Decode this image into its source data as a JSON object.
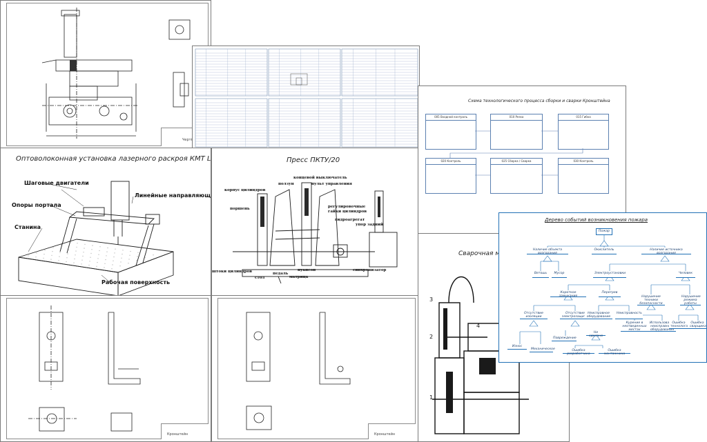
{
  "sheets": {
    "laser_title": "Оптоволоконная установка лазерного раскроя   КМТ L1",
    "laser_labels": {
      "steppers": "Шаговые двигатели",
      "linear_guides": "Линейные направляющие",
      "portal_supports": "Опоры портала",
      "bed": "Станина",
      "work_surface": "Рабочая поверхность"
    },
    "press_title": "Пресс ПКТУ/20",
    "press_labels": {
      "limit_switch": "концевой выключатель",
      "control_panel": "пульт управления",
      "frame": "ползун",
      "cylinder_body": "корпус цилиндров",
      "piston": "поршень",
      "adjusting_nuts": "регулировочные гайки цилиндров",
      "hydraulic_unit": "гидроагрегат",
      "back_stop": "упор задний",
      "cylinder_rods": "штоки цилиндров",
      "table": "стол",
      "pedal": "педаль",
      "punch": "пуансон",
      "die": "матрица",
      "synchronizer": "синхронизатор"
    },
    "process_title": "Схема технологического процесса сборки и сварки Кронштейна",
    "process_boxes": [
      "005 Входной контроль",
      "010 Резка",
      "015 Гибка",
      "020 Контроль",
      "025 Сборка / Сварка",
      "030 Контроль"
    ],
    "welding_title": "Сварочная машина",
    "welding_numbers": [
      "3",
      "2",
      "4",
      "1"
    ],
    "tree_title": "Дерево событий возникновения пожара",
    "tree_nodes": {
      "root": "Пожар",
      "n1": "Наличие объекта возгорания",
      "n2": "Окислитель",
      "n3": "Наличие источника возгорания",
      "n4": "Ветошь",
      "n5": "Мусор",
      "n6": "Электроустановки",
      "n7": "Человек",
      "n8": "Короткое замыкание",
      "n9": "Перегрев",
      "n10": "Нарушение техники безопасности",
      "n11": "Нарушение режима работы",
      "n12": "Отсутствие изоляции",
      "n13": "Отсутствие электрозащиты",
      "n14": "Неисправное оборудование",
      "n15": "Неисправность",
      "n16": "Курение в неотведенных местах",
      "n17": "Использование неисправного оборудования",
      "n18": "Ошибка технолога",
      "n19": "Ошибка сварщика",
      "n20": "Не сделано",
      "n21": "Износ",
      "n22": "Повреждение",
      "n23": "Механическое",
      "n24": "Ошибка разработчика",
      "n25": "Ошибка монтажника"
    },
    "gate_label": "или",
    "stamp_label_1": "Кронштейн",
    "stamp_label_2": "Чертёж"
  },
  "colors": {
    "line": "#1a1a1a",
    "tree_blue": "#1f6fb5",
    "box_blue": "#5a7fb0",
    "sheet_border": "#7a7a7a"
  }
}
